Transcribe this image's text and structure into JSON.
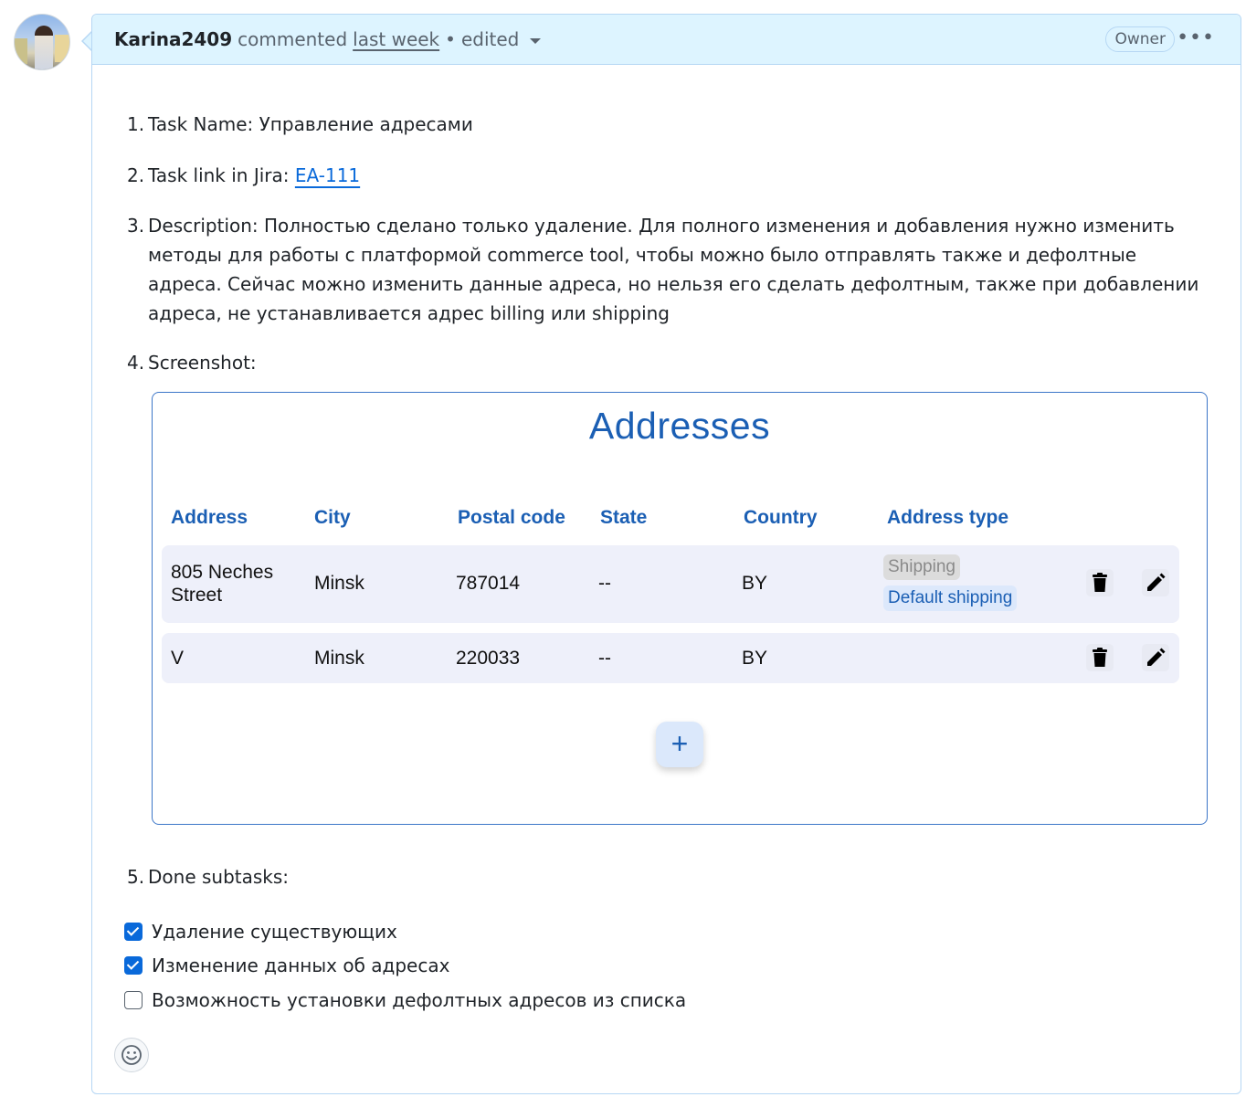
{
  "comment": {
    "author": "Karina2409",
    "action": "commented",
    "when": "last week",
    "separator": "•",
    "edited": "edited",
    "role_badge": "Owner",
    "more_menu": "•••"
  },
  "body": {
    "items": [
      {
        "num": "1.",
        "text": "Task Name: Управление адресами"
      },
      {
        "num": "2.",
        "prefix": "Task link in Jira: ",
        "link_text": "EA-111"
      },
      {
        "num": "3.",
        "text": "Description: Полностью сделано только удаление. Для полного изменения и добавления нужно изменить методы для работы с платформой commerce tool, чтобы можно было отправлять также и дефолтные адреса. Сейчас можно изменить данные адреса, но нельзя его сделать дефолтным, также при добавлении адреса, не устанавливается адрес billing или shipping"
      },
      {
        "num": "4.",
        "text": "Screenshot:"
      },
      {
        "num": "5.",
        "text": "Done subtasks:"
      }
    ],
    "subtasks": [
      {
        "label": "Удаление существующих",
        "checked": true
      },
      {
        "label": "Изменение данных об адресах",
        "checked": true
      },
      {
        "label": "Возможность установки дефолтных адресов из списка",
        "checked": false
      }
    ]
  },
  "screenshot": {
    "title": "Addresses",
    "columns": [
      "Address",
      "City",
      "Postal code",
      "State",
      "Country",
      "Address type"
    ],
    "rows": [
      {
        "address": "805 Neches Street",
        "city": "Minsk",
        "postal": "787014",
        "state": "--",
        "country": "BY",
        "types": [
          "Shipping",
          "Default shipping"
        ]
      },
      {
        "address": "V",
        "city": "Minsk",
        "postal": "220033",
        "state": "--",
        "country": "BY",
        "types": []
      }
    ],
    "add_button": "+"
  },
  "icons": {
    "delete": "trash-icon",
    "edit": "pencil-icon",
    "reaction": "smiley-icon"
  },
  "colors": {
    "header_bg": "#ddf4ff",
    "link": "#0969da",
    "screenshot_accent": "#1b5fb4"
  }
}
